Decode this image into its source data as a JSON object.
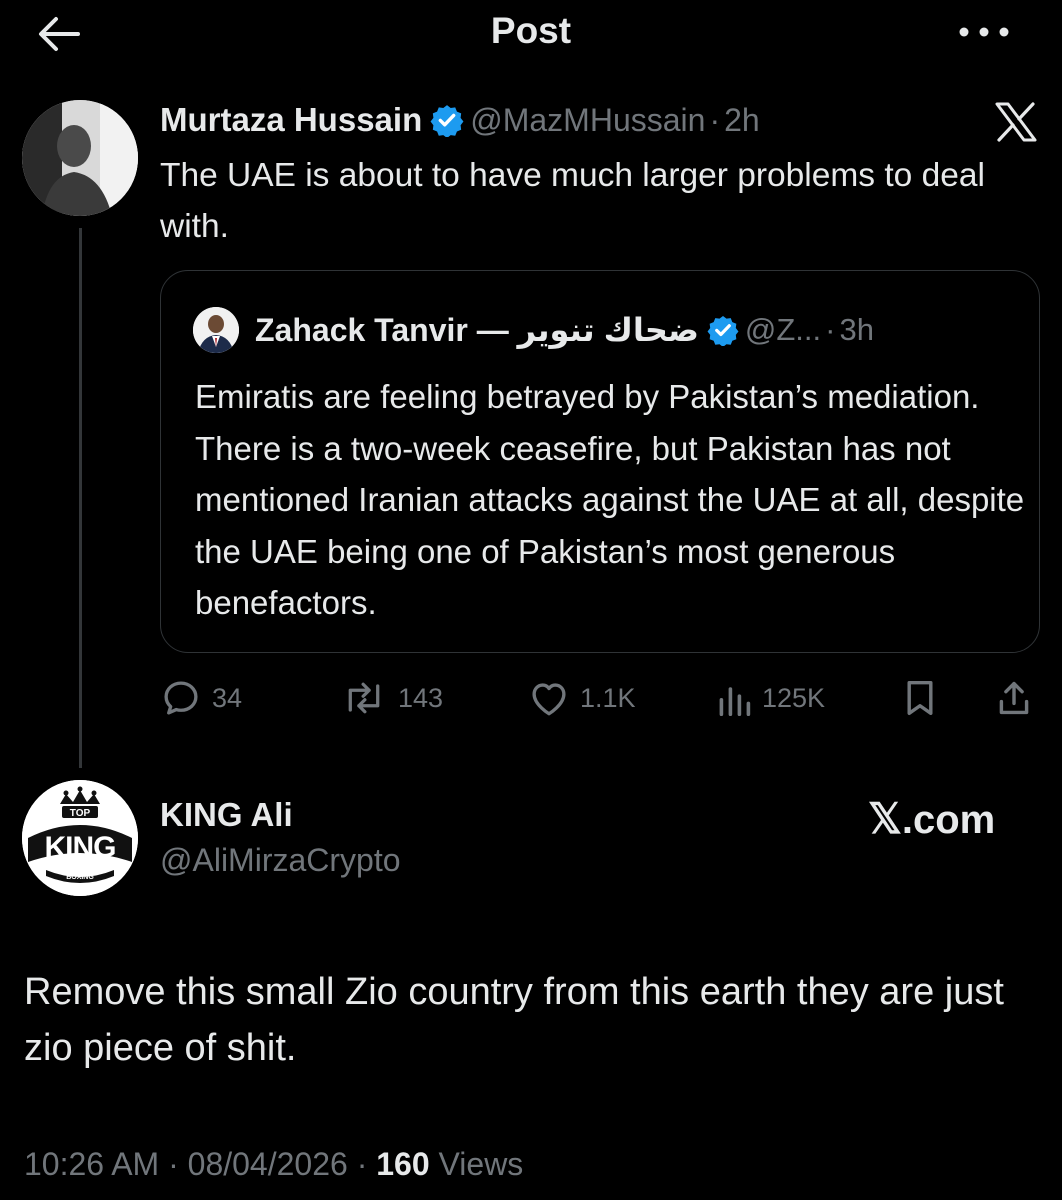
{
  "header": {
    "title": "Post"
  },
  "post": {
    "author_name": "Murtaza Hussain",
    "handle": "@MazMHussain",
    "separator": "·",
    "time": "2h",
    "text": "The UAE is about to have much larger problems to deal with.",
    "quote": {
      "author_name": "Zahack Tanvir — ضحاك تنوير",
      "handle": "@Z...",
      "separator": "·",
      "time": "3h",
      "text": "Emiratis are feeling betrayed by Pakistan’s mediation. There is a two-week ceasefire, but Pakistan has not mentioned Iranian attacks against the UAE at all, despite the UAE being one of Pakistan’s most generous benefactors."
    },
    "actions": {
      "replies": "34",
      "reposts": "143",
      "likes": "1.1K",
      "views": "125K"
    }
  },
  "reply": {
    "author_name": "KING Ali",
    "handle": "@AliMirzaCrypto",
    "text": "Remove this small Zio country from this earth they are just zio piece of shit.",
    "time": "10:26 AM",
    "separator": "·",
    "date": "08/04/2026",
    "views_count": "160",
    "views_label": "Views"
  },
  "watermark": {
    "x_char": "𝕏",
    "suffix": ".com"
  },
  "avatar_badge": {
    "top": "TOP",
    "king": "KING",
    "boxing": "BOXING"
  },
  "colors": {
    "background": "#000000",
    "text": "#e7e9ea",
    "secondary": "#71767b",
    "verified": "#1d9bf0",
    "border": "#2f3336"
  }
}
